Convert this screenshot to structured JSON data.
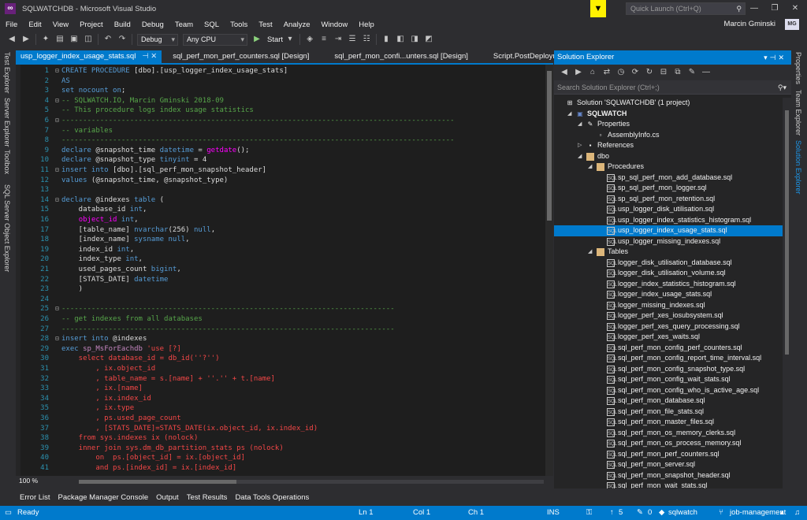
{
  "window": {
    "title": "SQLWATCHDB - Microsoft Visual Studio",
    "logo_glyph": "∞",
    "quick_launch_placeholder": "Quick Launch (Ctrl+Q)",
    "user_name": "Marcin Gminski",
    "user_initials": "MG"
  },
  "menu": [
    "File",
    "Edit",
    "View",
    "Project",
    "Build",
    "Debug",
    "Team",
    "SQL",
    "Tools",
    "Test",
    "Analyze",
    "Window",
    "Help"
  ],
  "toolbar": {
    "configuration": "Debug",
    "platform": "Any CPU",
    "start_label": "Start"
  },
  "left_strip": [
    "Test Explorer",
    "Server Explorer",
    "Toolbox",
    "SQL Server Object Explorer"
  ],
  "right_strip": [
    "Properties",
    "Team Explorer",
    "Solution Explorer"
  ],
  "doc_tabs": [
    {
      "label": "usp_logger_index_usage_stats.sql",
      "active": true
    },
    {
      "label": "sql_perf_mon_perf_counters.sql [Design]",
      "active": false
    },
    {
      "label": "sql_perf_mon_confi...unters.sql [Design]",
      "active": false
    },
    {
      "label": "Script.PostDeployment1.sql",
      "active": false
    }
  ],
  "code_lines": [
    {
      "n": "1",
      "fold": "⊟",
      "html": "<span class=\"kw\">CREATE PROCEDURE</span> [dbo].[usp_logger_index_usage_stats]"
    },
    {
      "n": "2",
      "fold": "",
      "html": "<span class=\"kw\">AS</span>"
    },
    {
      "n": "3",
      "fold": "",
      "html": "<span class=\"kw\">set</span> <span class=\"kw\">nocount</span> <span class=\"kw\">on</span>;"
    },
    {
      "n": "4",
      "fold": "⊟",
      "html": "<span class=\"cm\">-- SQLWATCH.IO, Marcin Gminski 2018-09</span>"
    },
    {
      "n": "5",
      "fold": "",
      "html": "<span class=\"cm\">-- This procedure logs index usage statistics</span>"
    },
    {
      "n": "6",
      "fold": "⊟",
      "html": "<span class=\"cm\">--------------------------------------------------------------------------------------------</span>"
    },
    {
      "n": "7",
      "fold": "",
      "html": "<span class=\"cm\">-- variables</span>"
    },
    {
      "n": "8",
      "fold": "",
      "html": "<span class=\"cm\">--------------------------------------------------------------------------------------------</span>"
    },
    {
      "n": "9",
      "fold": "",
      "html": "<span class=\"kw\">declare</span> @snapshot_time <span class=\"kw\">datetime</span> = <span class=\"fn\">getdate</span>();"
    },
    {
      "n": "10",
      "fold": "",
      "html": "<span class=\"kw\">declare</span> @snapshot_type <span class=\"kw\">tinyint</span> = 4"
    },
    {
      "n": "11",
      "fold": "⊟",
      "html": "<span class=\"kw\">insert into</span> [dbo].[sql_perf_mon_snapshot_header]"
    },
    {
      "n": "12",
      "fold": "",
      "html": "<span class=\"kw\">values</span> (@snapshot_time, @snapshot_type)"
    },
    {
      "n": "13",
      "fold": "",
      "html": ""
    },
    {
      "n": "14",
      "fold": "⊟",
      "html": "<span class=\"kw\">declare</span> @indexes <span class=\"kw\">table</span> ("
    },
    {
      "n": "15",
      "fold": "",
      "html": "    database_id <span class=\"kw\">int</span>,"
    },
    {
      "n": "16",
      "fold": "",
      "html": "    <span class=\"fn\">object_id</span> <span class=\"kw\">int</span>,"
    },
    {
      "n": "17",
      "fold": "",
      "html": "    [table_name] <span class=\"kw\">nvarchar</span>(256) <span class=\"kw\">null</span>,"
    },
    {
      "n": "18",
      "fold": "",
      "html": "    [index_name] <span class=\"kw\">sysname</span> <span class=\"kw\">null</span>,"
    },
    {
      "n": "19",
      "fold": "",
      "html": "    index_id <span class=\"kw\">int</span>,"
    },
    {
      "n": "20",
      "fold": "",
      "html": "    index_type <span class=\"kw\">int</span>,"
    },
    {
      "n": "21",
      "fold": "",
      "html": "    used_pages_count <span class=\"kw\">bigint</span>,"
    },
    {
      "n": "22",
      "fold": "",
      "html": "    [STATS_DATE] <span class=\"kw\">datetime</span>"
    },
    {
      "n": "23",
      "fold": "",
      "html": "    )"
    },
    {
      "n": "24",
      "fold": "",
      "html": ""
    },
    {
      "n": "25",
      "fold": "⊟",
      "html": "<span class=\"cm\">------------------------------------------------------------------------------</span>"
    },
    {
      "n": "26",
      "fold": "",
      "html": "<span class=\"cm\">-- get indexes from all databases</span>"
    },
    {
      "n": "27",
      "fold": "",
      "html": "<span class=\"cm\">------------------------------------------------------------------------------</span>"
    },
    {
      "n": "28",
      "fold": "⊟",
      "html": "<span class=\"kw\">insert into</span> @indexes"
    },
    {
      "n": "29",
      "fold": "",
      "html": "<span class=\"kw\">exec</span> <span class=\"sy\">sp_MsForEachdb</span> <span class=\"str\">'use [?]</span>"
    },
    {
      "n": "30",
      "fold": "",
      "html": "<span class=\"str\">    select database_id = db_id(''?'')</span>"
    },
    {
      "n": "31",
      "fold": "",
      "html": "<span class=\"str\">        , ix.object_id</span>"
    },
    {
      "n": "32",
      "fold": "",
      "html": "<span class=\"str\">        , table_name = s.[name] + ''.'' + t.[name]</span>"
    },
    {
      "n": "33",
      "fold": "",
      "html": "<span class=\"str\">        , ix.[name]</span>"
    },
    {
      "n": "34",
      "fold": "",
      "html": "<span class=\"str\">        , ix.index_id</span>"
    },
    {
      "n": "35",
      "fold": "",
      "html": "<span class=\"str\">        , ix.type</span>"
    },
    {
      "n": "36",
      "fold": "",
      "html": "<span class=\"str\">        , ps.used_page_count</span>"
    },
    {
      "n": "37",
      "fold": "",
      "html": "<span class=\"str\">        , [STATS_DATE]=STATS_DATE(ix.object_id, ix.index_id)</span>"
    },
    {
      "n": "38",
      "fold": "",
      "html": "<span class=\"str\">    from sys.indexes ix (nolock)</span>"
    },
    {
      "n": "39",
      "fold": "",
      "html": "<span class=\"str\">    inner join sys.dm_db_partition_stats ps (nolock)</span>"
    },
    {
      "n": "40",
      "fold": "",
      "html": "<span class=\"str\">        on  ps.[object_id] = ix.[object_id]</span>"
    },
    {
      "n": "41",
      "fold": "",
      "html": "<span class=\"str\">        and ps.[index_id] = ix.[index_id]</span>"
    }
  ],
  "zoom": "100 %",
  "solution_explorer": {
    "title": "Solution Explorer",
    "search_placeholder": "Search Solution Explorer (Ctrl+;)",
    "tree": [
      {
        "label": "Solution 'SQLWATCHDB' (1 project)",
        "level": 0,
        "arrow": "",
        "icon": "sol",
        "selected": false
      },
      {
        "label": "SQLWATCH",
        "level": 1,
        "arrow": "◢",
        "icon": "proj",
        "selected": false
      },
      {
        "label": "Properties",
        "level": 2,
        "arrow": "◢",
        "icon": "wrench",
        "selected": false
      },
      {
        "label": "AssemblyInfo.cs",
        "level": 3,
        "arrow": "",
        "icon": "cs",
        "selected": false
      },
      {
        "label": "References",
        "level": 2,
        "arrow": "▷",
        "icon": "ref",
        "selected": false
      },
      {
        "label": "dbo",
        "level": 2,
        "arrow": "◢",
        "icon": "folder",
        "selected": false
      },
      {
        "label": "Procedures",
        "level": 3,
        "arrow": "◢",
        "icon": "folder",
        "selected": false
      },
      {
        "label": "sp_sql_perf_mon_add_database.sql",
        "level": 4,
        "arrow": "",
        "icon": "sql",
        "selected": false
      },
      {
        "label": "sp_sql_perf_mon_logger.sql",
        "level": 4,
        "arrow": "",
        "icon": "sql",
        "selected": false
      },
      {
        "label": "sp_sql_perf_mon_retention.sql",
        "level": 4,
        "arrow": "",
        "icon": "sql",
        "selected": false
      },
      {
        "label": "usp_logger_disk_utilisation.sql",
        "level": 4,
        "arrow": "",
        "icon": "sql",
        "selected": false
      },
      {
        "label": "usp_logger_index_statistics_histogram.sql",
        "level": 4,
        "arrow": "",
        "icon": "sql",
        "selected": false
      },
      {
        "label": "usp_logger_index_usage_stats.sql",
        "level": 4,
        "arrow": "",
        "icon": "sql",
        "selected": true
      },
      {
        "label": "usp_logger_missing_indexes.sql",
        "level": 4,
        "arrow": "",
        "icon": "sql",
        "selected": false
      },
      {
        "label": "Tables",
        "level": 3,
        "arrow": "◢",
        "icon": "folder",
        "selected": false
      },
      {
        "label": "logger_disk_utilisation_database.sql",
        "level": 4,
        "arrow": "",
        "icon": "sql",
        "selected": false
      },
      {
        "label": "logger_disk_utilisation_volume.sql",
        "level": 4,
        "arrow": "",
        "icon": "sql",
        "selected": false
      },
      {
        "label": "logger_index_statistics_histogram.sql",
        "level": 4,
        "arrow": "",
        "icon": "sql",
        "selected": false
      },
      {
        "label": "logger_index_usage_stats.sql",
        "level": 4,
        "arrow": "",
        "icon": "sql",
        "selected": false
      },
      {
        "label": "logger_missing_indexes.sql",
        "level": 4,
        "arrow": "",
        "icon": "sql",
        "selected": false
      },
      {
        "label": "logger_perf_xes_iosubsystem.sql",
        "level": 4,
        "arrow": "",
        "icon": "sql",
        "selected": false
      },
      {
        "label": "logger_perf_xes_query_processing.sql",
        "level": 4,
        "arrow": "",
        "icon": "sql",
        "selected": false
      },
      {
        "label": "logger_perf_xes_waits.sql",
        "level": 4,
        "arrow": "",
        "icon": "sql",
        "selected": false
      },
      {
        "label": "sql_perf_mon_config_perf_counters.sql",
        "level": 4,
        "arrow": "",
        "icon": "sql",
        "selected": false
      },
      {
        "label": "sql_perf_mon_config_report_time_interval.sql",
        "level": 4,
        "arrow": "",
        "icon": "sql",
        "selected": false
      },
      {
        "label": "sql_perf_mon_config_snapshot_type.sql",
        "level": 4,
        "arrow": "",
        "icon": "sql",
        "selected": false
      },
      {
        "label": "sql_perf_mon_config_wait_stats.sql",
        "level": 4,
        "arrow": "",
        "icon": "sql",
        "selected": false
      },
      {
        "label": "sql_perf_mon_config_who_is_active_age.sql",
        "level": 4,
        "arrow": "",
        "icon": "sql",
        "selected": false
      },
      {
        "label": "sql_perf_mon_database.sql",
        "level": 4,
        "arrow": "",
        "icon": "sql",
        "selected": false
      },
      {
        "label": "sql_perf_mon_file_stats.sql",
        "level": 4,
        "arrow": "",
        "icon": "sql",
        "selected": false
      },
      {
        "label": "sql_perf_mon_master_files.sql",
        "level": 4,
        "arrow": "",
        "icon": "sql",
        "selected": false
      },
      {
        "label": "sql_perf_mon_os_memory_clerks.sql",
        "level": 4,
        "arrow": "",
        "icon": "sql",
        "selected": false
      },
      {
        "label": "sql_perf_mon_os_process_memory.sql",
        "level": 4,
        "arrow": "",
        "icon": "sql",
        "selected": false
      },
      {
        "label": "sql_perf_mon_perf_counters.sql",
        "level": 4,
        "arrow": "",
        "icon": "sql",
        "selected": false
      },
      {
        "label": "sql_perf_mon_server.sql",
        "level": 4,
        "arrow": "",
        "icon": "sql",
        "selected": false
      },
      {
        "label": "sql_perf_mon_snapshot_header.sql",
        "level": 4,
        "arrow": "",
        "icon": "sql",
        "selected": false
      },
      {
        "label": "sql_perf_mon_wait_stats.sql",
        "level": 4,
        "arrow": "",
        "icon": "sql",
        "selected": false
      }
    ]
  },
  "bottom_tabs": [
    "Error List",
    "Package Manager Console",
    "Output",
    "Test Results",
    "Data Tools Operations"
  ],
  "status": {
    "ready": "Ready",
    "ln": "Ln 1",
    "col": "Col 1",
    "ch": "Ch 1",
    "ins": "INS",
    "up_count": "5",
    "edits": "0",
    "repo": "sqlwatch",
    "branch": "job-management"
  },
  "colors": {
    "accent": "#007acc",
    "background": "#2d2d30",
    "editor": "#1e1e1e"
  }
}
